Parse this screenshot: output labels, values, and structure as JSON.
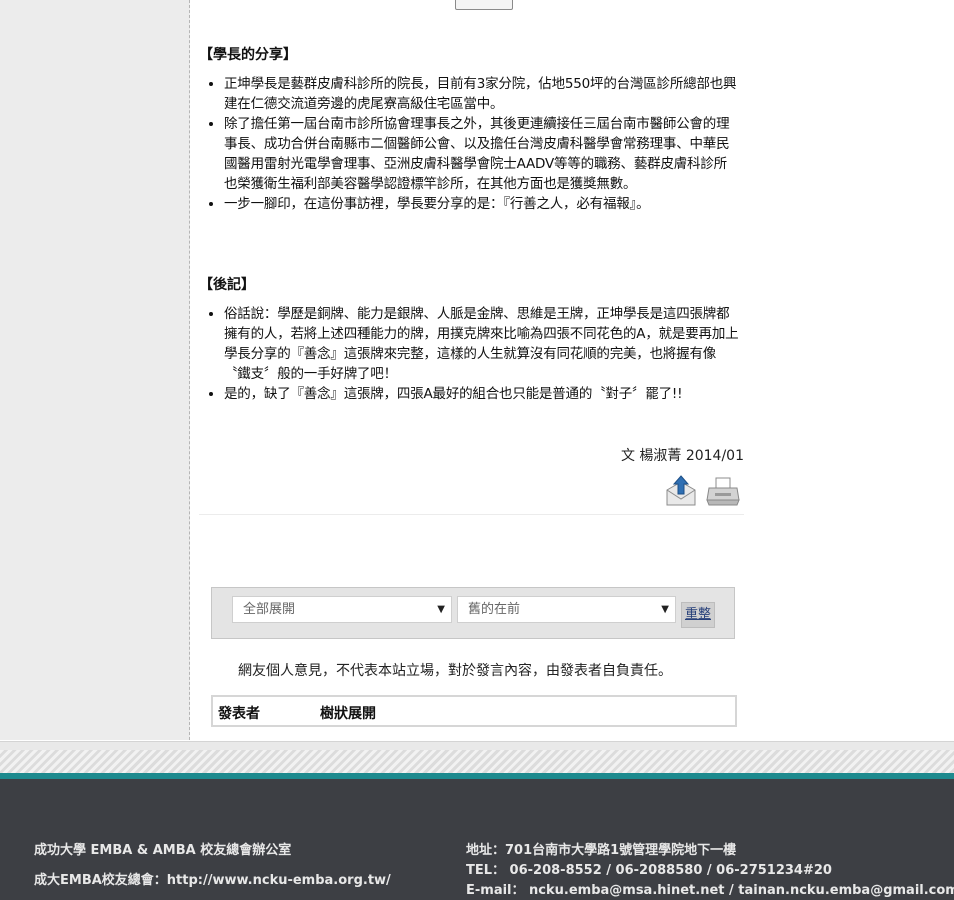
{
  "share": {
    "title": "【學長的分享】",
    "items": [
      "正坤學長是藝群皮膚科診所的院長，目前有3家分院，佔地550坪的台灣區診所總部也興建在仁德交流道旁邊的虎尾寮高級住宅區當中。",
      "除了擔任第一屆台南市診所協會理事長之外，其後更連續接任三屆台南市醫師公會的理事長、成功合併台南縣市二個醫師公會、以及擔任台灣皮膚科醫學會常務理事、中華民國醫用雷射光電學會理事、亞洲皮膚科醫學會院士AADV等等的職務、藝群皮膚科診所也榮獲衛生福利部美容醫學認證標竿診所，在其他方面也是獲獎無數。",
      "一步一腳印，在這份事訪裡，學長要分享的是：『行善之人，必有福報』。"
    ]
  },
  "postscript": {
    "title": "【後記】",
    "items": [
      "俗話說：學歷是銅牌、能力是銀牌、人脈是金牌、思維是王牌，正坤學長是這四張牌都擁有的人，若將上述四種能力的牌，用撲克牌來比喻為四張不同花色的A，就是要再加上學長分享的『善念』這張牌來完整，這樣的人生就算沒有同花順的完美，也將握有像〝鐵支〞般的一手好牌了吧！",
      "是的，缺了『善念』這張牌，四張A最好的組合也只能是普通的〝對子〞罷了!!"
    ]
  },
  "signature": "文 楊淑菁 2014/01",
  "icons": {
    "share": "email-share-icon",
    "print": "printer-icon"
  },
  "filters": {
    "expand_select": "全部展開",
    "order_select": "舊的在前",
    "reset_label": "重整"
  },
  "disclaimer": "網友個人意見，不代表本站立場，對於發言內容，由發表者自負責任。",
  "comment_table": {
    "col_author": "發表者",
    "col_view": "樹狀展開"
  },
  "footer": {
    "office": "成功大學 EMBA & AMBA 校友總會辦公室",
    "website": "成大EMBA校友總會：http://www.ncku-emba.org.tw/",
    "address": "地址：701台南市大學路1號管理學院地下一樓",
    "tel": "TEL： 06-208-8552 / 06-2088580 / 06-2751234#20",
    "email": "E-mail： ncku.emba@msa.hinet.net / tainan.ncku.emba@gmail.com"
  },
  "colors": {
    "teal_band": "#1d8a8e",
    "footer_bg": "#3d3f44",
    "link_blue": "#27407a"
  }
}
